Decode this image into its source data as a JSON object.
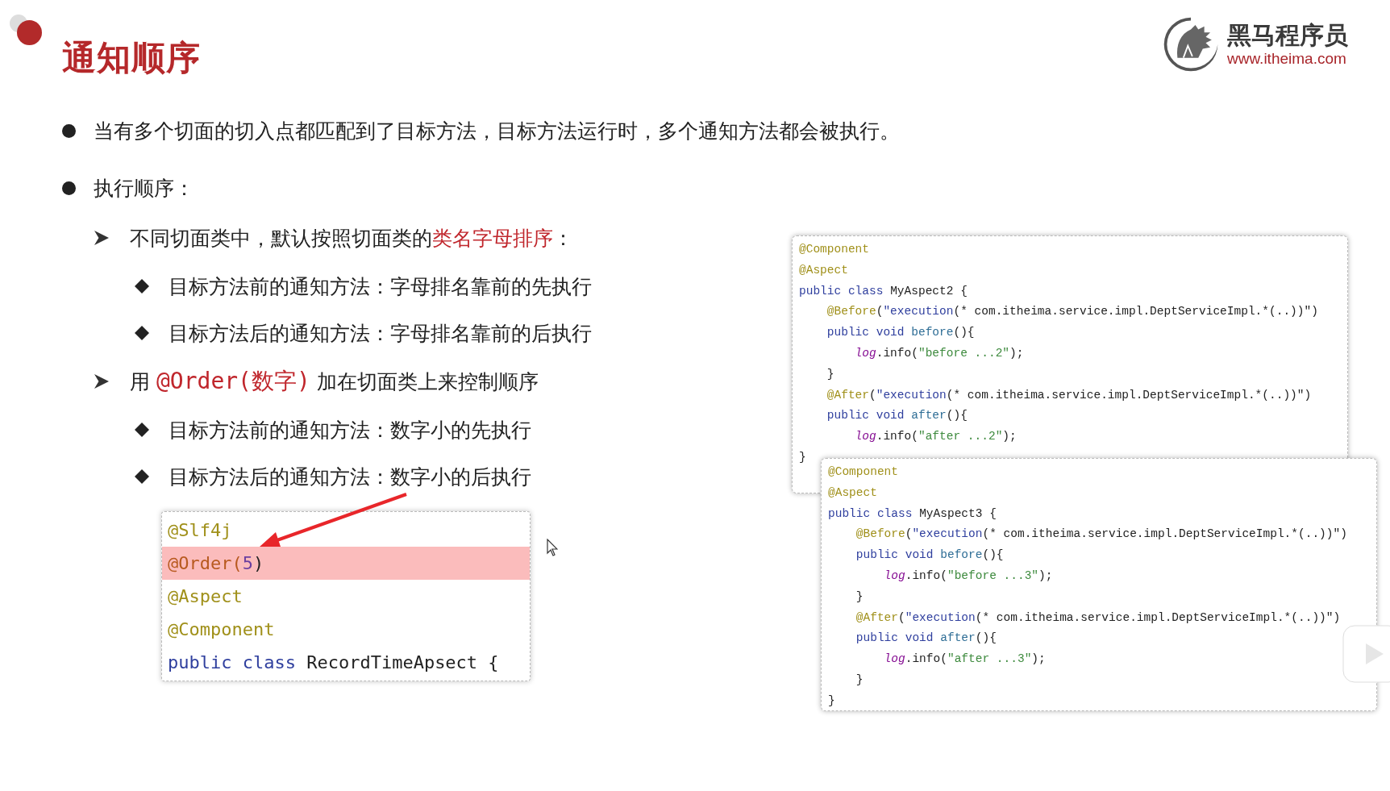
{
  "title": "通知顺序",
  "logo": {
    "name": "黑马程序员",
    "url": "www.itheima.com"
  },
  "bullets": [
    {
      "kind": "dot",
      "segments": [
        {
          "text": "当有多个切面的切入点都匹配到了目标方法，目标方法运行时，多个通知方法都会被执行。",
          "emphasis": false
        }
      ]
    },
    {
      "kind": "dot",
      "segments": [
        {
          "text": "执行顺序：",
          "emphasis": false
        }
      ],
      "children": [
        {
          "kind": "arrow",
          "segments": [
            {
              "text": "不同切面类中，默认按照切面类的",
              "emphasis": false
            },
            {
              "text": "类名字母排序",
              "emphasis": true
            },
            {
              "text": "：",
              "emphasis": false
            }
          ],
          "children": [
            {
              "kind": "diamond",
              "segments": [
                {
                  "text": "目标方法前的通知方法：字母排名靠前的先执行",
                  "emphasis": false
                }
              ]
            },
            {
              "kind": "diamond",
              "segments": [
                {
                  "text": "目标方法后的通知方法：字母排名靠前的后执行",
                  "emphasis": false
                }
              ]
            }
          ]
        },
        {
          "kind": "arrow",
          "segments": [
            {
              "text": "用 ",
              "emphasis": false
            },
            {
              "text": "@Order(数字)",
              "emphasis": true,
              "code": true
            },
            {
              "text": " 加在切面类上来控制顺序",
              "emphasis": false
            }
          ],
          "children": [
            {
              "kind": "diamond",
              "segments": [
                {
                  "text": "目标方法前的通知方法：数字小的先执行",
                  "emphasis": false
                }
              ]
            },
            {
              "kind": "diamond",
              "segments": [
                {
                  "text": "目标方法后的通知方法：数字小的后执行",
                  "emphasis": false
                }
              ]
            }
          ]
        }
      ]
    }
  ],
  "snippet": {
    "lines": [
      {
        "highlighted": false,
        "tokens": [
          {
            "text": "@Slf4j",
            "kind": "annotation"
          }
        ]
      },
      {
        "highlighted": true,
        "tokens": [
          {
            "text": "@Order(",
            "kind": "marked"
          },
          {
            "text": "5",
            "kind": "number"
          },
          {
            "text": ")",
            "kind": "plain"
          }
        ]
      },
      {
        "highlighted": false,
        "tokens": [
          {
            "text": "@Aspect",
            "kind": "annotation"
          }
        ]
      },
      {
        "highlighted": false,
        "tokens": [
          {
            "text": "@Component",
            "kind": "annotation"
          }
        ]
      },
      {
        "highlighted": false,
        "tokens": [
          {
            "text": "public class ",
            "kind": "keyword"
          },
          {
            "text": "RecordTimeApsect {",
            "kind": "plain"
          }
        ]
      }
    ]
  },
  "code_panels": [
    {
      "lines": [
        [
          {
            "text": "@Component",
            "kind": "annotation"
          }
        ],
        [
          {
            "text": "@Aspect",
            "kind": "annotation"
          }
        ],
        [
          {
            "text": "public class ",
            "kind": "keyword"
          },
          {
            "text": "MyAspect2 {",
            "kind": "plain"
          }
        ],
        [
          {
            "text": "    @Before",
            "kind": "annotation"
          },
          {
            "text": "(",
            "kind": "plain"
          },
          {
            "text": "\"execution",
            "kind": "keyword"
          },
          {
            "text": "(* com.itheima.service.impl.DeptServiceImpl.*(..))\")",
            "kind": "plain"
          }
        ],
        [
          {
            "text": "    public void ",
            "kind": "keyword"
          },
          {
            "text": "before",
            "kind": "method"
          },
          {
            "text": "(){",
            "kind": "plain"
          }
        ],
        [
          {
            "text": "        log",
            "kind": "field"
          },
          {
            "text": ".info(",
            "kind": "plain"
          },
          {
            "text": "\"before ...2\"",
            "kind": "string"
          },
          {
            "text": ");",
            "kind": "plain"
          }
        ],
        [
          {
            "text": "    }",
            "kind": "plain"
          }
        ],
        [
          {
            "text": "    @After",
            "kind": "annotation"
          },
          {
            "text": "(",
            "kind": "plain"
          },
          {
            "text": "\"execution",
            "kind": "keyword"
          },
          {
            "text": "(* com.itheima.service.impl.DeptServiceImpl.*(..))\")",
            "kind": "plain"
          }
        ],
        [
          {
            "text": "    public void ",
            "kind": "keyword"
          },
          {
            "text": "after",
            "kind": "method"
          },
          {
            "text": "(){",
            "kind": "plain"
          }
        ],
        [
          {
            "text": "        log",
            "kind": "field"
          },
          {
            "text": ".info(",
            "kind": "plain"
          },
          {
            "text": "\"after ...2\"",
            "kind": "string"
          },
          {
            "text": ");",
            "kind": "plain"
          }
        ],
        [
          {
            "text": "}",
            "kind": "plain"
          }
        ]
      ]
    },
    {
      "lines": [
        [
          {
            "text": "@Component",
            "kind": "annotation"
          }
        ],
        [
          {
            "text": "@Aspect",
            "kind": "annotation"
          }
        ],
        [
          {
            "text": "public class ",
            "kind": "keyword"
          },
          {
            "text": "MyAspect3 {",
            "kind": "plain"
          }
        ],
        [
          {
            "text": "    @Before",
            "kind": "annotation"
          },
          {
            "text": "(",
            "kind": "plain"
          },
          {
            "text": "\"execution",
            "kind": "keyword"
          },
          {
            "text": "(* com.itheima.service.impl.DeptServiceImpl.*(..))\")",
            "kind": "plain"
          }
        ],
        [
          {
            "text": "    public void ",
            "kind": "keyword"
          },
          {
            "text": "before",
            "kind": "method"
          },
          {
            "text": "(){",
            "kind": "plain"
          }
        ],
        [
          {
            "text": "        log",
            "kind": "field"
          },
          {
            "text": ".info(",
            "kind": "plain"
          },
          {
            "text": "\"before ...3\"",
            "kind": "string"
          },
          {
            "text": ");",
            "kind": "plain"
          }
        ],
        [
          {
            "text": "    }",
            "kind": "plain"
          }
        ],
        [
          {
            "text": "    @After",
            "kind": "annotation"
          },
          {
            "text": "(",
            "kind": "plain"
          },
          {
            "text": "\"execution",
            "kind": "keyword"
          },
          {
            "text": "(* com.itheima.service.impl.DeptServiceImpl.*(..))\")",
            "kind": "plain"
          }
        ],
        [
          {
            "text": "    public void ",
            "kind": "keyword"
          },
          {
            "text": "after",
            "kind": "method"
          },
          {
            "text": "(){",
            "kind": "plain"
          }
        ],
        [
          {
            "text": "        log",
            "kind": "field"
          },
          {
            "text": ".info(",
            "kind": "plain"
          },
          {
            "text": "\"after ...3\"",
            "kind": "string"
          },
          {
            "text": ");",
            "kind": "plain"
          }
        ],
        [
          {
            "text": "    }",
            "kind": "plain"
          }
        ],
        [
          {
            "text": "}",
            "kind": "plain"
          }
        ]
      ]
    }
  ]
}
